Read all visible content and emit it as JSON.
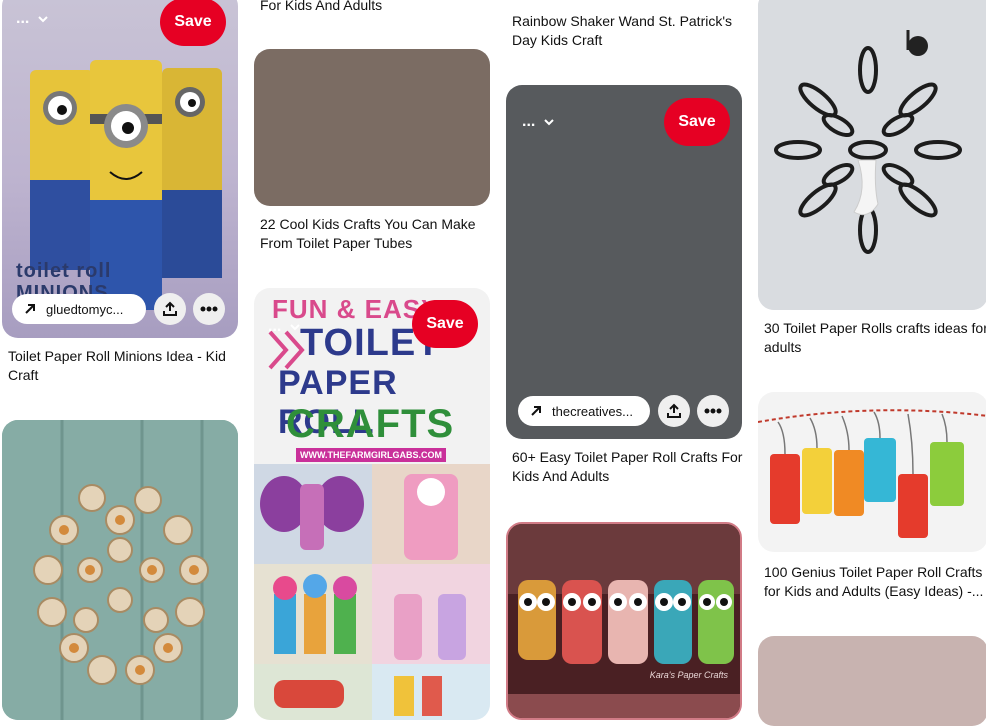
{
  "pins": {
    "minions": {
      "save_label": "Save",
      "more_label": "...",
      "source_label": "gluedtomyc...",
      "title": "Toilet Paper Roll Minions Idea - Kid Craft",
      "overlay_text": "toilet roll MINIONS"
    },
    "top_mid_caption": "For Kids And Adults",
    "cool_kids": {
      "title": "22 Cool Kids Crafts You Can Make From Toilet Paper Tubes",
      "placeholder_color": "#7b6c63"
    },
    "rainbow": {
      "title": "Rainbow Shaker Wand St. Patrick's Day Kids Craft"
    },
    "creatives": {
      "save_label": "Save",
      "more_label": "...",
      "source_label": "thecreatives...",
      "title": "60+ Easy Toilet Paper Roll Crafts For Kids And Adults",
      "placeholder_color": "#575a5d"
    },
    "lamp": {
      "title": "30 Toilet Paper Rolls crafts ideas for adults"
    },
    "fun_easy": {
      "save_label": "Save",
      "more_label": "...",
      "heading_line1": "FUN & EASY",
      "heading_line2": "TOILET",
      "heading_line3": "PAPER ROLL",
      "heading_line4": "CRAFTS",
      "site_label": "WWW.THEFARMGIRLGABS.COM"
    },
    "lanterns": {
      "title": "100 Genius Toilet Paper Roll Crafts for Kids and Adults (Easy Ideas) -..."
    },
    "owls": {
      "watermark": "Kara's Paper Crafts"
    },
    "bottom_right": {
      "placeholder_color": "#c8b3b0"
    }
  },
  "colors": {
    "save_red": "#e60023"
  },
  "icons": [
    "arrow-up-right-icon",
    "share-icon",
    "more-dots-icon",
    "chevron-down-icon"
  ]
}
